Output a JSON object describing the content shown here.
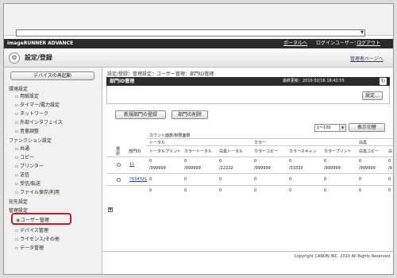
{
  "browser": {
    "url": "",
    "dropdown_icon": "chevron-down-icon"
  },
  "header": {
    "logo_prefix": "imageRUNNER ADVANCE",
    "portal_link": "ポータルへ",
    "login_user": "ログインユーザー：1",
    "logout": "ログアウト"
  },
  "title": {
    "page_title": "設定/登録",
    "to_mgmt": "管理者ページへ"
  },
  "sidebar": {
    "restart_button": "デバイスの再起動",
    "sections": [
      {
        "label": "環境設定",
        "items": [
          "用紙設定",
          "タイマー/電力設定",
          "ネットワーク",
          "外部インタフェイス",
          "音量調整"
        ]
      },
      {
        "label": "ファンクション設定",
        "items": [
          "共通",
          "コピー",
          "プリンター",
          "送信",
          "受信/転送",
          "ファイル保存/利用"
        ]
      },
      {
        "label": "宛先設定",
        "items": []
      },
      {
        "label": "管理設定",
        "items": [
          "ユーザー管理",
          "デバイス管理",
          "ライセンス/その他",
          "データ管理"
        ]
      }
    ],
    "active_item": "ユーザー管理"
  },
  "main": {
    "breadcrumb": "設定/登録：管理設定：ユーザー管理：部門ID管理",
    "panel_title": "部門ID管理",
    "last_updated": "最終更新：2010 02/16 18:42:55",
    "settings_button": "設定...",
    "register_button": "新規部門の登録",
    "delete_button": "部門の削除",
    "range_select": "1〜100",
    "display_button": "表示切替",
    "table": {
      "group_header": "カウント面数/制限面数",
      "sub_total": "トータル",
      "sub_color": "カラー",
      "sub_bw": "白黒",
      "col_select": "選択",
      "col_dept": "部門ID",
      "columns": [
        "トータルプリント",
        "カラートータル",
        "白黒トータル",
        "カラーコピー",
        "カラースキャン",
        "カラープリント",
        "白黒コピー",
        "白"
      ],
      "rows": [
        {
          "id": "11",
          "counts": [
            "0",
            "0",
            "0",
            "0",
            "0",
            "0",
            "0",
            "0"
          ],
          "limits": [
            "/999999",
            "/999999",
            "/22222",
            "/999999",
            "/33333",
            "/999999",
            "/999999",
            "/9"
          ]
        },
        {
          "id": "7654321",
          "counts": [
            "0",
            "0",
            "0",
            "0",
            "0",
            "0",
            "0",
            "0"
          ],
          "limits": [
            "",
            "",
            "",
            "",
            "",
            "",
            "",
            ""
          ]
        },
        {
          "id": "",
          "counts": [
            "0",
            "0",
            "0",
            "0",
            "0",
            "0",
            "0",
            "0"
          ],
          "limits": [
            "",
            "",
            "",
            "",
            "",
            "",
            "",
            ""
          ]
        }
      ]
    }
  },
  "footer": {
    "copyright": "Copyright CANON INC. 2010 All Rights Reserved"
  }
}
